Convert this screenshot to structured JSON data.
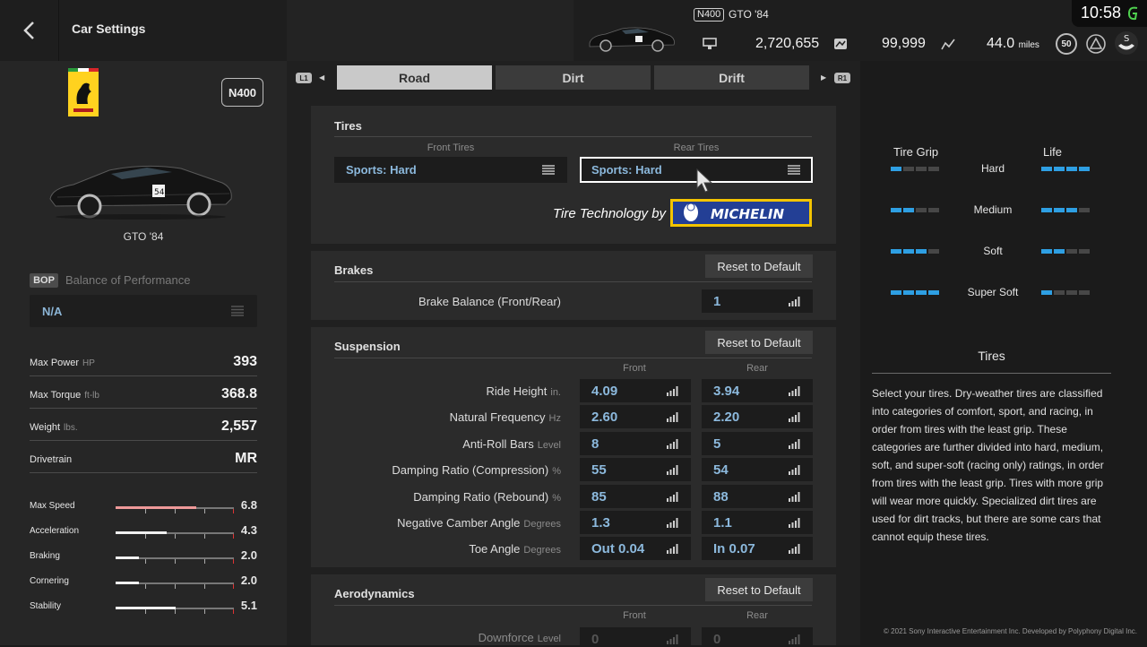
{
  "header": {
    "back_icon": "chevron-left-icon",
    "title": "Car Settings",
    "car_class": "N400",
    "car_name": "GTO '84",
    "credits": "2,720,655",
    "mileage_points": "99,999",
    "distance": "44.0",
    "distance_unit": "miles",
    "level": "50",
    "clock": "10:58"
  },
  "car": {
    "class": "N400",
    "name": "GTO '84",
    "bop_badge": "BOP",
    "bop_label": "Balance of Performance",
    "bop_value": "N/A",
    "specs": [
      {
        "label": "Max Power",
        "unit": "HP",
        "value": "393"
      },
      {
        "label": "Max Torque",
        "unit": "ft-lb",
        "value": "368.8"
      },
      {
        "label": "Weight",
        "unit": "lbs.",
        "value": "2,557"
      },
      {
        "label": "Drivetrain",
        "unit": "",
        "value": "MR"
      }
    ],
    "performance": [
      {
        "label": "Max Speed",
        "value": "6.8",
        "level": 0.68
      },
      {
        "label": "Acceleration",
        "value": "4.3",
        "level": 0.43
      },
      {
        "label": "Braking",
        "value": "2.0",
        "level": 0.2
      },
      {
        "label": "Cornering",
        "value": "2.0",
        "level": 0.2
      },
      {
        "label": "Stability",
        "value": "5.1",
        "level": 0.51
      }
    ]
  },
  "tabs": {
    "left_button": "L1",
    "right_button": "R1",
    "items": [
      "Road",
      "Dirt",
      "Drift"
    ],
    "active": "Road"
  },
  "tires": {
    "title": "Tires",
    "front_label": "Front Tires",
    "rear_label": "Rear Tires",
    "front_value": "Sports: Hard",
    "rear_value": "Sports: Hard",
    "tech_label": "Tire Technology by",
    "brand": "MICHELIN"
  },
  "brakes": {
    "title": "Brakes",
    "reset_label": "Reset to Default",
    "balance_label": "Brake Balance (Front/Rear)",
    "balance_value": "1"
  },
  "suspension": {
    "title": "Suspension",
    "reset_label": "Reset to Default",
    "front_label": "Front",
    "rear_label": "Rear",
    "rows": [
      {
        "label": "Ride Height",
        "unit": "in.",
        "front": "4.09",
        "rear": "3.94"
      },
      {
        "label": "Natural Frequency",
        "unit": "Hz",
        "front": "2.60",
        "rear": "2.20"
      },
      {
        "label": "Anti-Roll Bars",
        "unit": "Level",
        "front": "8",
        "rear": "5"
      },
      {
        "label": "Damping Ratio (Compression)",
        "unit": "%",
        "front": "55",
        "rear": "54"
      },
      {
        "label": "Damping Ratio (Rebound)",
        "unit": "%",
        "front": "85",
        "rear": "88"
      },
      {
        "label": "Negative Camber Angle",
        "unit": "Degrees",
        "front": "1.3",
        "rear": "1.1"
      },
      {
        "label": "Toe Angle",
        "unit": "Degrees",
        "front": "Out 0.04",
        "rear": "In 0.07"
      }
    ]
  },
  "aero": {
    "title": "Aerodynamics",
    "reset_label": "Reset to Default",
    "front_label": "Front",
    "rear_label": "Rear",
    "downforce_label": "Downforce",
    "downforce_unit": "Level",
    "front_value": "0",
    "rear_value": "0"
  },
  "compounds": {
    "grip_label": "Tire Grip",
    "life_label": "Life",
    "accent_color": "#2e9fe3",
    "items": [
      {
        "name": "Hard",
        "grip": 1,
        "life": 4
      },
      {
        "name": "Medium",
        "grip": 2,
        "life": 3
      },
      {
        "name": "Soft",
        "grip": 3,
        "life": 2
      },
      {
        "name": "Super Soft",
        "grip": 4,
        "life": 1
      }
    ]
  },
  "info": {
    "title": "Tires",
    "body": "Select your tires. Dry-weather tires are classified into categories of comfort, sport, and racing, in order from tires with the least grip. These categories are further divided into hard, medium, soft, and super-soft (racing only) ratings, in order from tires with the least grip. Tires with more grip will wear more quickly. Specialized dirt tires are used for dirt tracks, but there are some cars that cannot equip these tires."
  },
  "footer": {
    "copyright": "© 2021 Sony Interactive Entertainment Inc. Developed by Polyphony Digital Inc."
  }
}
